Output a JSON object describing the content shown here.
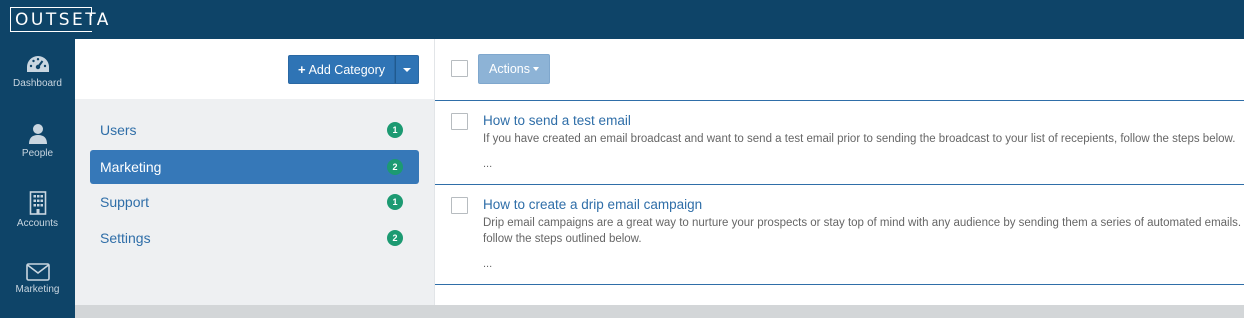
{
  "app": {
    "logo_text": "OUTSETA"
  },
  "sidebar": {
    "items": [
      {
        "label": "Dashboard",
        "icon": "dashboard-icon"
      },
      {
        "label": "People",
        "icon": "person-icon"
      },
      {
        "label": "Accounts",
        "icon": "building-icon"
      },
      {
        "label": "Marketing",
        "icon": "envelope-icon"
      }
    ]
  },
  "categories": {
    "add_button_label": "Add Category",
    "items": [
      {
        "label": "Users",
        "count": "1",
        "active": false
      },
      {
        "label": "Marketing",
        "count": "2",
        "active": true
      },
      {
        "label": "Support",
        "count": "1",
        "active": false
      },
      {
        "label": "Settings",
        "count": "2",
        "active": false
      }
    ]
  },
  "content": {
    "actions_label": "Actions",
    "articles": [
      {
        "title": "How to send a test email",
        "desc_lines": [
          "If you have created an email broadcast and want to send a test email prior to sending the broadcast to your list of recepients, follow the steps below."
        ],
        "ellipsis": "..."
      },
      {
        "title": "How to create a drip email campaign",
        "desc_lines": [
          "Drip email campaigns are a great way to nurture your prospects or stay top of mind with any audience by sending them a series of automated emails.",
          "follow the steps outlined below."
        ],
        "ellipsis": "..."
      }
    ]
  },
  "colors": {
    "nav_bg": "#0e4468",
    "primary": "#2f74b5",
    "active_category": "#3678b8",
    "badge": "#1c9a72",
    "link": "#2f6ea8"
  }
}
